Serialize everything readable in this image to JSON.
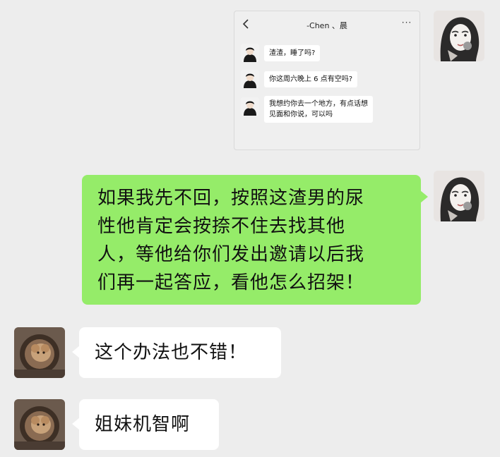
{
  "embedded_screenshot": {
    "title": "-Chen 、晨",
    "more_label": "···",
    "messages": [
      "渣渣，睡了吗?",
      "你这周六晚上 6 点有空吗?",
      "我想约你去一个地方，有点话想\n见面和你说，可以吗"
    ]
  },
  "chat": {
    "messages": [
      {
        "side": "right",
        "text": "如果我先不回，按照这渣男的尿\n性他肯定会按捺不住去找其他\n人，等他给你们发出邀请以后我\n们再一起答应，看他怎么招架！"
      },
      {
        "side": "left",
        "text": "这个办法也不错！"
      },
      {
        "side": "left",
        "text": "姐妹机智啊"
      }
    ]
  },
  "colors": {
    "background": "#ededed",
    "sent_bubble": "#95ec69",
    "received_bubble": "#ffffff"
  }
}
